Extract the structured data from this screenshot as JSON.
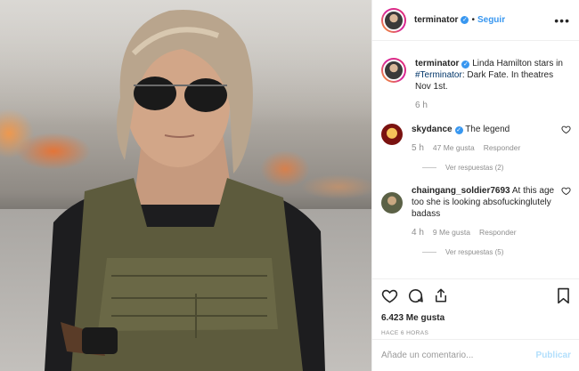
{
  "header": {
    "username": "terminator",
    "separator": "•",
    "follow_label": "Seguir",
    "more_icon": "more-horizontal-icon"
  },
  "caption": {
    "username": "terminator",
    "text_before": " Linda Hamilton stars in ",
    "hashtag": "#Terminator",
    "text_after": ": Dark Fate. In theatres Nov 1st.",
    "time": "6 h"
  },
  "comments": [
    {
      "username": "skydance",
      "verified": true,
      "text": " The legend",
      "time": "5 h",
      "likes": "47 Me gusta",
      "reply_label": "Responder",
      "view_replies": "Ver respuestas (2)"
    },
    {
      "username": "chaingang_soldier7693",
      "verified": false,
      "text": " At this age too she is looking absofuckinglutely badass",
      "time": "4 h",
      "likes": "9 Me gusta",
      "reply_label": "Responder",
      "view_replies": "Ver respuestas (5)"
    }
  ],
  "actions": {
    "like_icon": "heart-icon",
    "comment_icon": "comment-icon",
    "share_icon": "share-icon",
    "save_icon": "bookmark-icon",
    "likes_count": "6.423 Me gusta",
    "posted_ago": "HACE 6 HORAS"
  },
  "add_comment": {
    "placeholder": "Añade un comentario...",
    "publish_label": "Publicar"
  },
  "colors": {
    "link_blue": "#3897f0",
    "hashtag": "#003569",
    "muted": "#8e8e8e",
    "publish_disabled": "#b2dffc"
  }
}
